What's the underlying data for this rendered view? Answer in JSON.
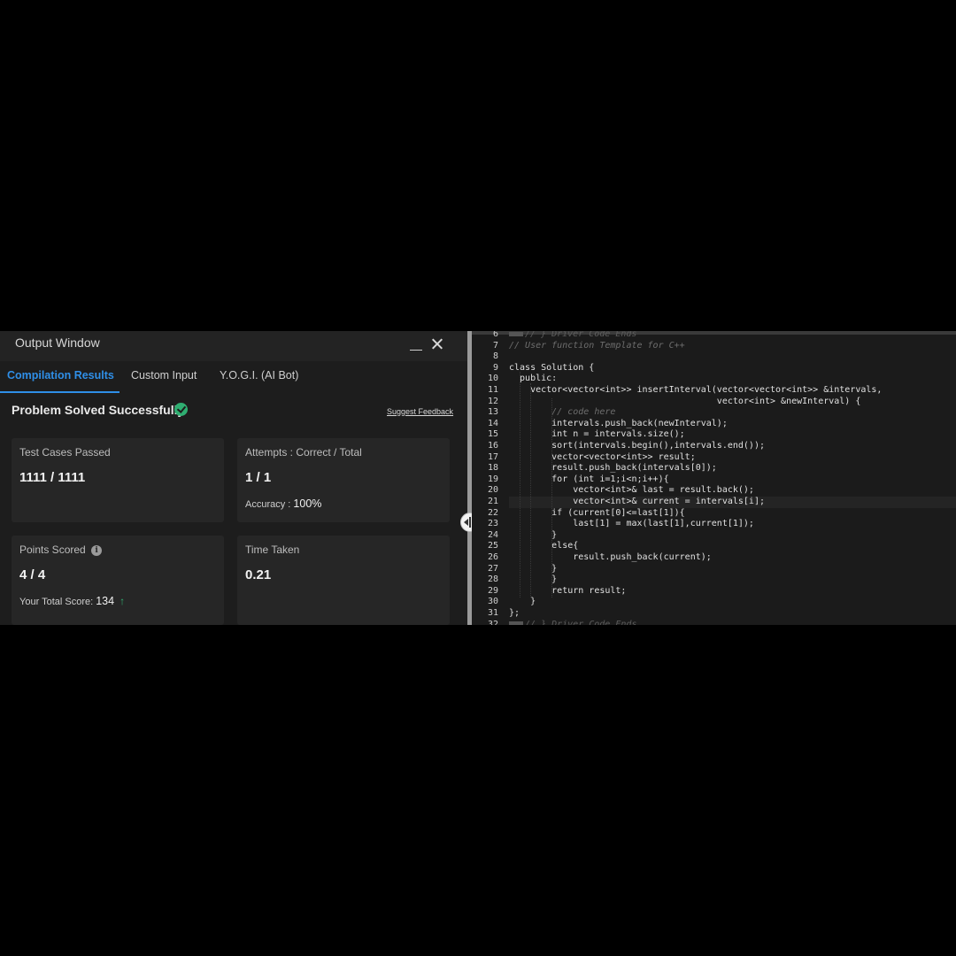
{
  "output_window": {
    "title": "Output Window",
    "tabs": [
      {
        "label": "Compilation Results",
        "active": true
      },
      {
        "label": "Custom Input",
        "active": false
      },
      {
        "label": "Y.O.G.I. (AI Bot)",
        "active": false
      }
    ],
    "status": "Problem Solved Successfully",
    "feedback_link": "Suggest Feedback",
    "cards": {
      "tests": {
        "label": "Test Cases Passed",
        "value": "1111 / 1111"
      },
      "attempts": {
        "label": "Attempts : Correct / Total",
        "value": "1 / 1",
        "sub_label": "Accuracy :",
        "sub_value": "100%"
      },
      "points": {
        "label": "Points Scored",
        "value": "4 / 4",
        "sub_label": "Your Total Score:",
        "sub_value": "134"
      },
      "time": {
        "label": "Time Taken",
        "value": "0.21"
      }
    },
    "icons": {
      "status": "check-circle-icon",
      "info": "info-icon",
      "trend": "arrow-up-icon"
    },
    "colors": {
      "accent": "#2f8fe8",
      "success": "#2fae71"
    }
  },
  "editor": {
    "lines": [
      {
        "n": "6",
        "text": "// } Driver Code Ends",
        "style": "dim",
        "fold": true
      },
      {
        "n": "7",
        "text": "// User function Template for C++",
        "style": "comment"
      },
      {
        "n": "8",
        "text": ""
      },
      {
        "n": "9",
        "text": "class Solution {"
      },
      {
        "n": "10",
        "text": "  public:"
      },
      {
        "n": "11",
        "text": "    vector<vector<int>> insertInterval(vector<vector<int>> &intervals,"
      },
      {
        "n": "12",
        "text": "                                       vector<int> &newInterval) {"
      },
      {
        "n": "13",
        "text": "        // code here",
        "style": "comment"
      },
      {
        "n": "14",
        "text": "        intervals.push_back(newInterval);"
      },
      {
        "n": "15",
        "text": "        int n = intervals.size();"
      },
      {
        "n": "16",
        "text": "        sort(intervals.begin(),intervals.end());"
      },
      {
        "n": "17",
        "text": "        vector<vector<int>> result;"
      },
      {
        "n": "18",
        "text": "        result.push_back(intervals[0]);"
      },
      {
        "n": "19",
        "text": "        for (int i=1;i<n;i++){"
      },
      {
        "n": "20",
        "text": "            vector<int>& last = result.back();"
      },
      {
        "n": "21",
        "text": "            vector<int>& current = intervals[i];",
        "highlight": true
      },
      {
        "n": "22",
        "text": "        if (current[0]<=last[1]){"
      },
      {
        "n": "23",
        "text": "            last[1] = max(last[1],current[1]);"
      },
      {
        "n": "24",
        "text": "        }"
      },
      {
        "n": "25",
        "text": "        else{"
      },
      {
        "n": "26",
        "text": "            result.push_back(current);"
      },
      {
        "n": "27",
        "text": "        }"
      },
      {
        "n": "28",
        "text": "        }"
      },
      {
        "n": "29",
        "text": "        return result;"
      },
      {
        "n": "30",
        "text": "    }"
      },
      {
        "n": "31",
        "text": "};"
      },
      {
        "n": "32",
        "text": "// } Driver Code Ends",
        "style": "dim",
        "fold": true
      }
    ]
  }
}
